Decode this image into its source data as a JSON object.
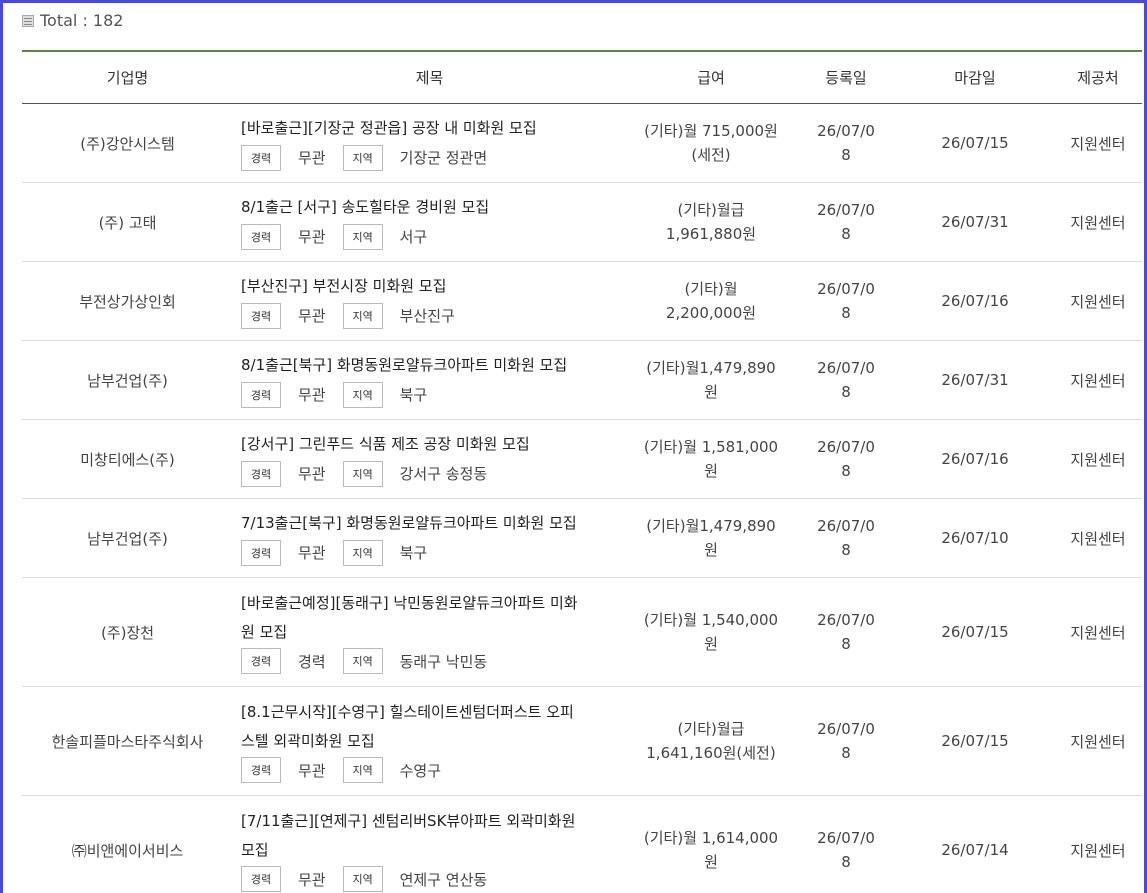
{
  "header": {
    "total_label": "Total : 182"
  },
  "columns": [
    "기업명",
    "제목",
    "급여",
    "등록일",
    "마감일",
    "제공처"
  ],
  "tag_labels": {
    "experience": "경력",
    "region": "지역"
  },
  "rows": [
    {
      "company": "(주)강안시스템",
      "title": "[바로출근][기장군 정관읍] 공장 내 미화원 모집",
      "experience": "무관",
      "region": "기장군 정관면",
      "salary": "(기타)월 715,000원\n(세전)",
      "registered": "26/07/0\n8",
      "deadline": "26/07/15",
      "provider": "지원센터"
    },
    {
      "company": "(주) 고태",
      "title": "8/1출근 [서구] 송도힐타운 경비원 모집",
      "experience": "무관",
      "region": "서구",
      "salary": "(기타)월급\n1,961,880원",
      "registered": "26/07/0\n8",
      "deadline": "26/07/31",
      "provider": "지원센터"
    },
    {
      "company": "부전상가상인회",
      "title": "[부산진구] 부전시장 미화원 모집",
      "experience": "무관",
      "region": "부산진구",
      "salary": "(기타)월\n2,200,000원",
      "registered": "26/07/0\n8",
      "deadline": "26/07/16",
      "provider": "지원센터"
    },
    {
      "company": "남부건업(주)",
      "title": "8/1출근[북구] 화명동원로얄듀크아파트 미화원 모집",
      "experience": "무관",
      "region": "북구",
      "salary": "(기타)월1,479,890\n원",
      "registered": "26/07/0\n8",
      "deadline": "26/07/31",
      "provider": "지원센터"
    },
    {
      "company": "미창티에스(주)",
      "title": "[강서구] 그린푸드 식품 제조 공장 미화원 모집",
      "experience": "무관",
      "region": "강서구 송정동",
      "salary": "(기타)월 1,581,000\n원",
      "registered": "26/07/0\n8",
      "deadline": "26/07/16",
      "provider": "지원센터"
    },
    {
      "company": "남부건업(주)",
      "title": "7/13출근[북구] 화명동원로얄듀크아파트 미화원 모집",
      "experience": "무관",
      "region": "북구",
      "salary": "(기타)월1,479,890\n원",
      "registered": "26/07/0\n8",
      "deadline": "26/07/10",
      "provider": "지원센터"
    },
    {
      "company": "(주)장천",
      "title": "[바로출근예정][동래구] 낙민동원로얄듀크아파트 미화\n원 모집",
      "experience": "경력",
      "region": "동래구 낙민동",
      "salary": "(기타)월 1,540,000\n원",
      "registered": "26/07/0\n8",
      "deadline": "26/07/15",
      "provider": "지원센터"
    },
    {
      "company": "한솔피플마스타주식회사",
      "title": "[8.1근무시작][수영구] 힐스테이트센텀더퍼스트 오피\n스텔 외곽미화원 모집",
      "experience": "무관",
      "region": "수영구",
      "salary": "(기타)월급\n1,641,160원(세전)",
      "registered": "26/07/0\n8",
      "deadline": "26/07/15",
      "provider": "지원센터"
    },
    {
      "company": "㈜비앤에이서비스",
      "title": "[7/11출근][연제구] 센텀리버SK뷰아파트 외곽미화원\n모집",
      "experience": "무관",
      "region": "연제구 연산동",
      "salary": "(기타)월 1,614,000\n원",
      "registered": "26/07/0\n8",
      "deadline": "26/07/14",
      "provider": "지원센터"
    }
  ]
}
